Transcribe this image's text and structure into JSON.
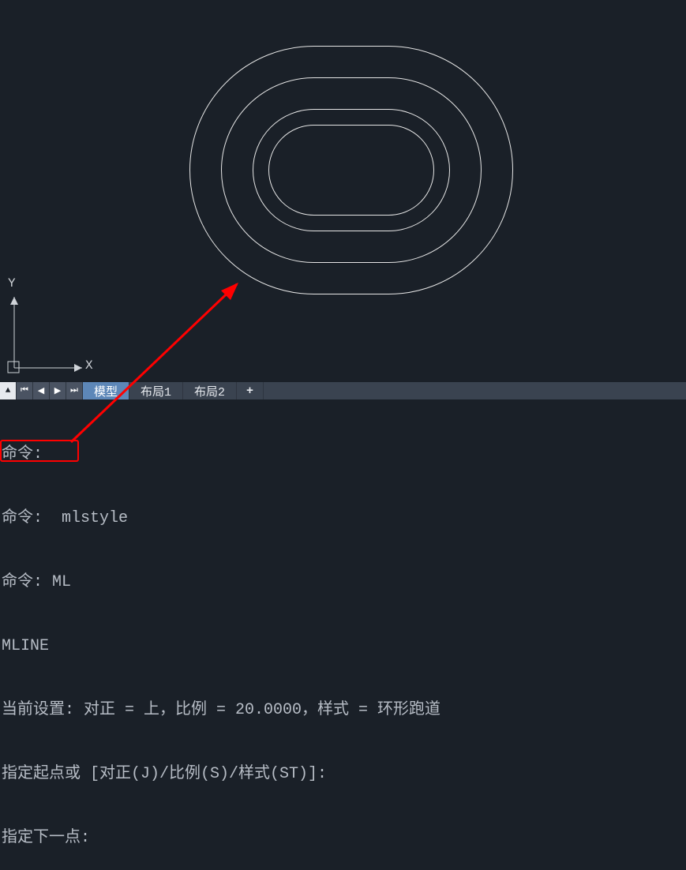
{
  "ucs": {
    "x_label": "X",
    "y_label": "Y"
  },
  "tabs": {
    "active": "模型",
    "layout1": "布局1",
    "layout2": "布局2",
    "add": "+"
  },
  "nav": {
    "menu": "▲",
    "first": "⏮",
    "prev": "◀",
    "next": "▶",
    "last": "⏭"
  },
  "cmd": {
    "l1": "命令:",
    "l2": "命令:  mlstyle",
    "l3": "命令: ML",
    "l4": "MLINE",
    "l5": "当前设置: 对正 = 上，比例 = 20.0000，样式 = 环形跑道",
    "l6": "指定起点或 [对正(J)/比例(S)/样式(ST)]:",
    "l7": "指定下一点:"
  }
}
